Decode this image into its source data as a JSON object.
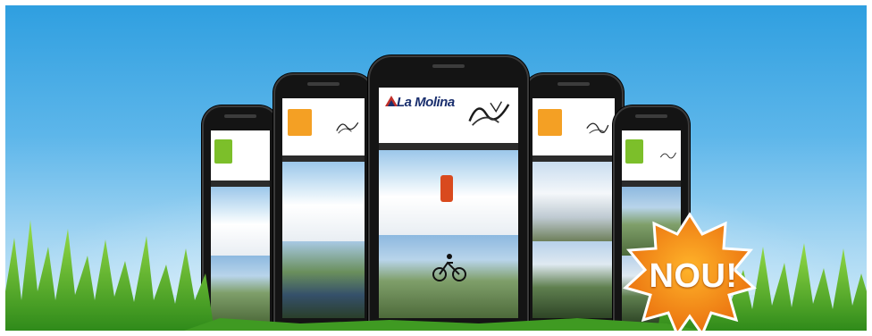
{
  "banner": {
    "badge_label": "NOU!",
    "center_phone_brand": "La Molina",
    "colors": {
      "sky_top": "#2f9fe0",
      "sky_bottom": "#d6eefa",
      "grass": "#5fbf2c",
      "badge_orange": "#f08a12",
      "phone_body": "#141414"
    },
    "icons": [
      "phone-mockup",
      "starburst-badge",
      "grass-blades"
    ]
  }
}
